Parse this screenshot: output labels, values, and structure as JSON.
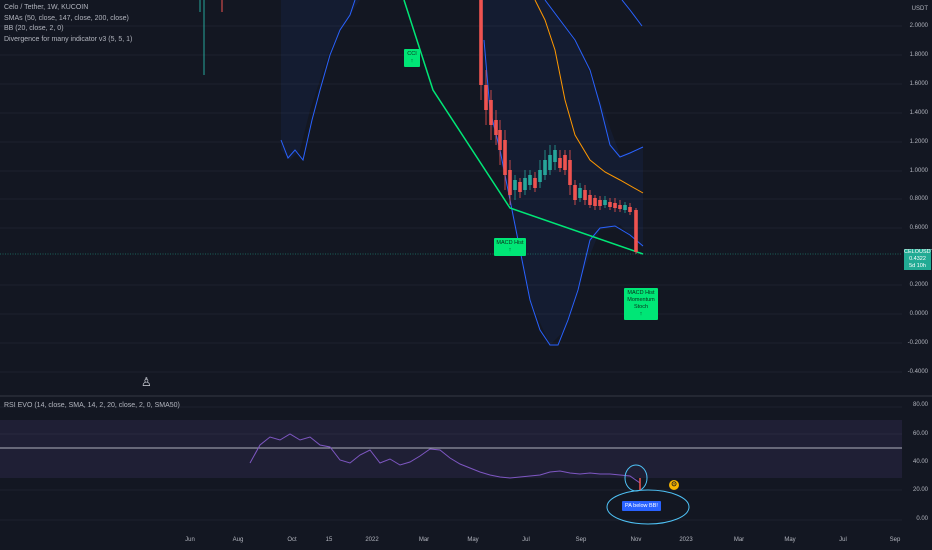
{
  "legend": {
    "symbol": "Celo / Tether, 1W, KUCOIN",
    "smas": "SMAs (50, close, 147, close, 200, close)",
    "bb": "BB (20, close, 2, 0)",
    "divergence": "Divergence for many indicator v3 (5, 5, 1)"
  },
  "rsi_legend": "RSI EVO (14, close, SMA, 14, 2, 20, close, 2, 0, SMA50)",
  "price_axis": {
    "currency": "USDT",
    "ticks": [
      "2.0000",
      "1.8000",
      "1.6000",
      "1.4000",
      "1.2000",
      "1.0000",
      "0.8000",
      "0.6000",
      "0.2000",
      "0.0000",
      "-0.2000",
      "-0.4000"
    ],
    "last_price_label": "CELOUSDT",
    "last_price": "0.4322",
    "countdown": "5d 10h"
  },
  "rsi_axis": {
    "ticks": [
      "80.00",
      "60.00",
      "40.00",
      "20.00",
      "0.00"
    ]
  },
  "time_axis": [
    "Jun",
    "Aug",
    "Oct",
    "15",
    "2022",
    "Mar",
    "May",
    "Jul",
    "Sep",
    "Nov",
    "2023",
    "Mar",
    "May",
    "Jul",
    "Sep"
  ],
  "annotations": {
    "top_label": "CCI\n↑",
    "macd_label": "MACD Hist\n↑",
    "macd_hist_label": "MACD Hist\nMomentum\nStoch\n↑",
    "pa_below": "PA below BB!",
    "coin_icon": "coin-icon",
    "cursor_icon": "cursor-icon"
  },
  "colors": {
    "background": "#131722",
    "up_candle": "#26a69a",
    "down_candle": "#ef5350",
    "bb_band": "#2962ff",
    "sma": "#ff9800",
    "trendline": "#00e676",
    "rsi_line": "#7e57c2"
  },
  "chart_data": {
    "type": "candlestick",
    "symbol": "CELOUSDT",
    "ylim": [
      -0.4,
      2.0
    ],
    "rsi_ylim": [
      0,
      80
    ],
    "closes": [
      1.9,
      1.6,
      1.4,
      1.05,
      1.0,
      0.85,
      0.9,
      0.95,
      1.0,
      0.92,
      0.8,
      0.78,
      0.78,
      0.76,
      0.74,
      0.43
    ]
  }
}
